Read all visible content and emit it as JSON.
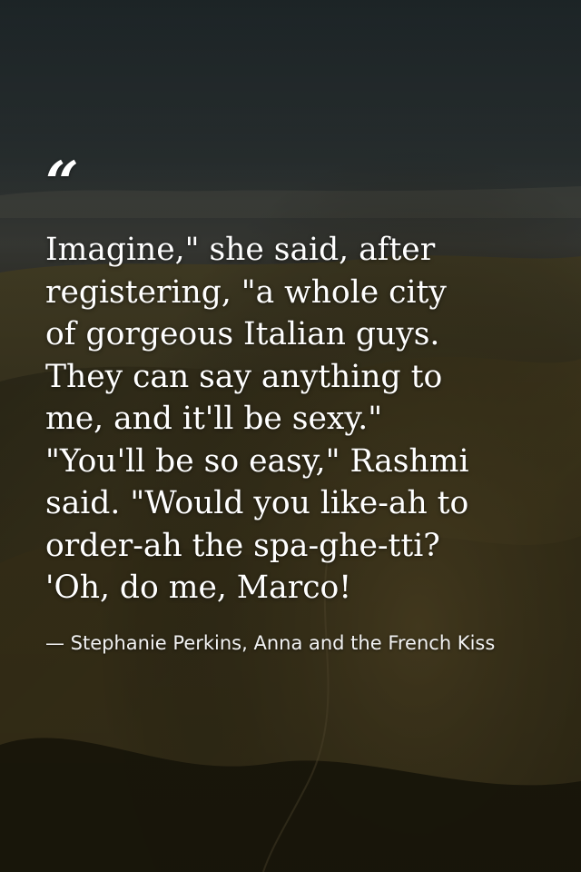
{
  "quote": {
    "mark": "“",
    "text": "Imagine,\" she said, after\nregistering, \"a whole city\nof gorgeous Italian guys.\nThey can say anything to\nme, and it'll be sexy.\"\n\"You'll be so easy,\" Rashmi\nsaid. \"Would you like-ah to\norder-ah the spa-ghe-tti?\n'Oh, do me, Marco!",
    "attribution": "— Stephanie Perkins, Anna and the French Kiss"
  },
  "colors": {
    "text": "#ffffff",
    "sky_top": "#2b3335",
    "hills": "#4a4226",
    "overlay": "#000000"
  }
}
